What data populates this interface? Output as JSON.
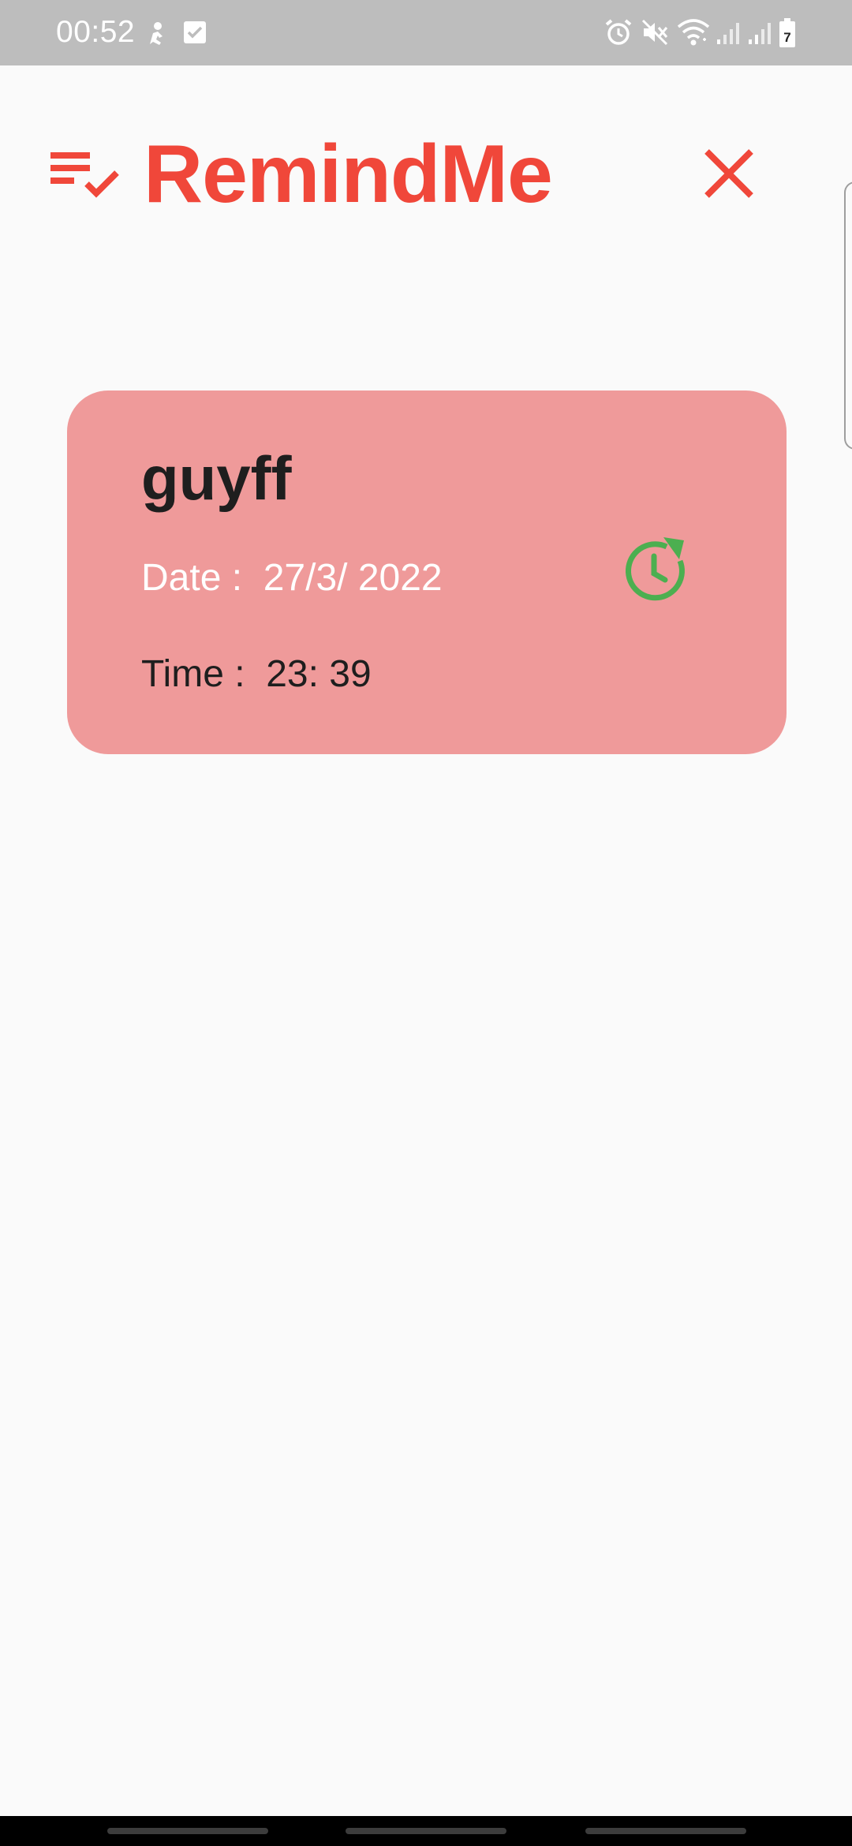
{
  "status_bar": {
    "time": "00:52",
    "battery_level": "7",
    "background_color": "#BDBDBD",
    "left_icons": [
      "person-notification-icon",
      "checkbox-notification-icon"
    ],
    "right_icons": [
      "alarm-icon",
      "mute-icon",
      "wifi-icon",
      "signal-icon",
      "signal-icon",
      "battery-icon"
    ]
  },
  "app_bar": {
    "title": "RemindMe",
    "accent_color": "#F0473A",
    "leading_icon": "playlist-check-icon",
    "trailing_icon": "close-icon"
  },
  "reminders": [
    {
      "title": "guyff",
      "date_label": "Date :  27/3/ 2022",
      "time_label": "Time :  23: 39",
      "card_color": "#EF9A9A",
      "action_icon": "snooze-icon",
      "action_icon_color": "#4CAF50"
    }
  ]
}
